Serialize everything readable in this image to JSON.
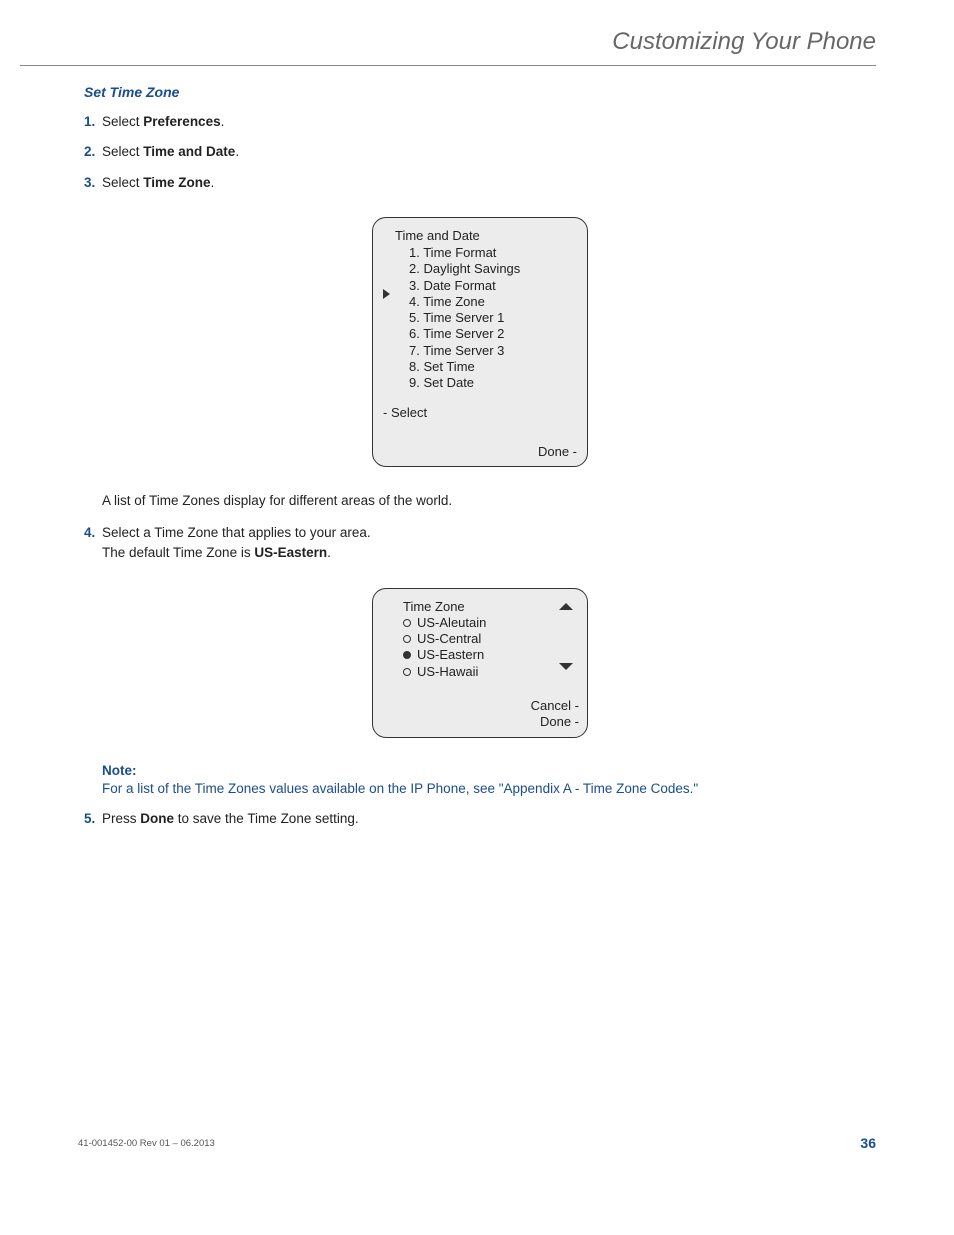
{
  "header": {
    "title": "Customizing Your Phone"
  },
  "section": {
    "title": "Set Time Zone"
  },
  "steps": {
    "s1": {
      "num": "1.",
      "prefix": "Select ",
      "bold": "Preferences",
      "suffix": "."
    },
    "s2": {
      "num": "2.",
      "prefix": "Select ",
      "bold": "Time and Date",
      "suffix": "."
    },
    "s3": {
      "num": "3.",
      "prefix": "Select ",
      "bold": "Time Zone",
      "suffix": "."
    },
    "s4": {
      "num": "4.",
      "line1": "Select a Time Zone that applies to your area.",
      "line2a": "The default Time Zone is ",
      "line2b": "US-Eastern",
      "line2c": "."
    },
    "s5": {
      "num": "5.",
      "prefix": "Press ",
      "bold": "Done",
      "suffix": " to save the Time Zone setting."
    }
  },
  "body": {
    "after_screen1": "A list of Time Zones display for different areas of the world."
  },
  "screen1": {
    "title": "Time and Date",
    "items": {
      "i1": "1. Time Format",
      "i2": "2. Daylight Savings",
      "i3": "3. Date Format",
      "i4": "4. Time Zone",
      "i5": "5. Time Server 1",
      "i6": "6. Time Server 2",
      "i7": "7. Time Server 3",
      "i8": "8. Set Time",
      "i9": "9. Set Date"
    },
    "select": "- Select",
    "done": "Done -"
  },
  "screen2": {
    "title": "Time Zone",
    "opts": {
      "o1": "US-Aleutain",
      "o2": "US-Central",
      "o3": "US-Eastern",
      "o4": "US-Hawaii"
    },
    "cancel": "Cancel -",
    "done": "Done -"
  },
  "note": {
    "label": "Note:",
    "text": "For a list of the Time Zones values available on the IP Phone, see ",
    "link": "\"Appendix A - Time Zone Codes.\""
  },
  "footer": {
    "left": "41-001452-00 Rev 01 – 06.2013",
    "right": "36"
  }
}
